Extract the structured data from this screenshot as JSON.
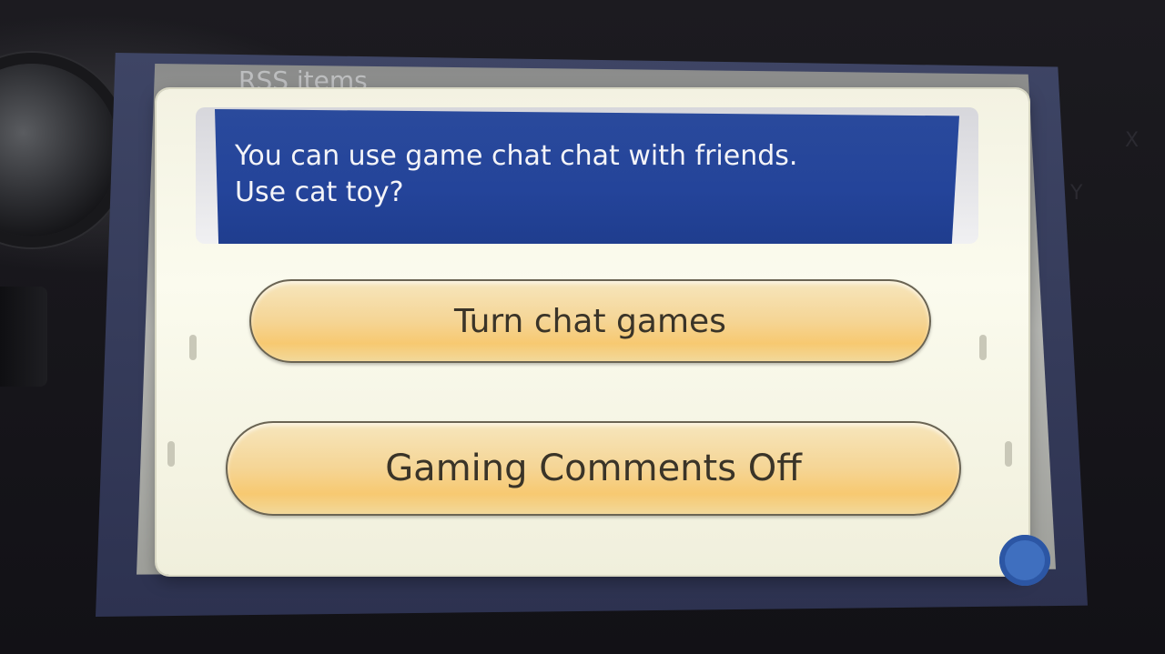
{
  "device": {
    "glyph_x": "X",
    "glyph_y": "Y"
  },
  "background_screen": {
    "title": "RSS items"
  },
  "dialog": {
    "message_line1": "You can use game chat chat with friends.",
    "message_line2": "Use cat toy?",
    "choices": [
      {
        "label": "Turn chat games"
      },
      {
        "label": "Gaming Comments Off"
      }
    ]
  },
  "colors": {
    "banner": "#24449a",
    "button_fill": "#f7c971",
    "dialog_bg": "#fbfbee"
  }
}
